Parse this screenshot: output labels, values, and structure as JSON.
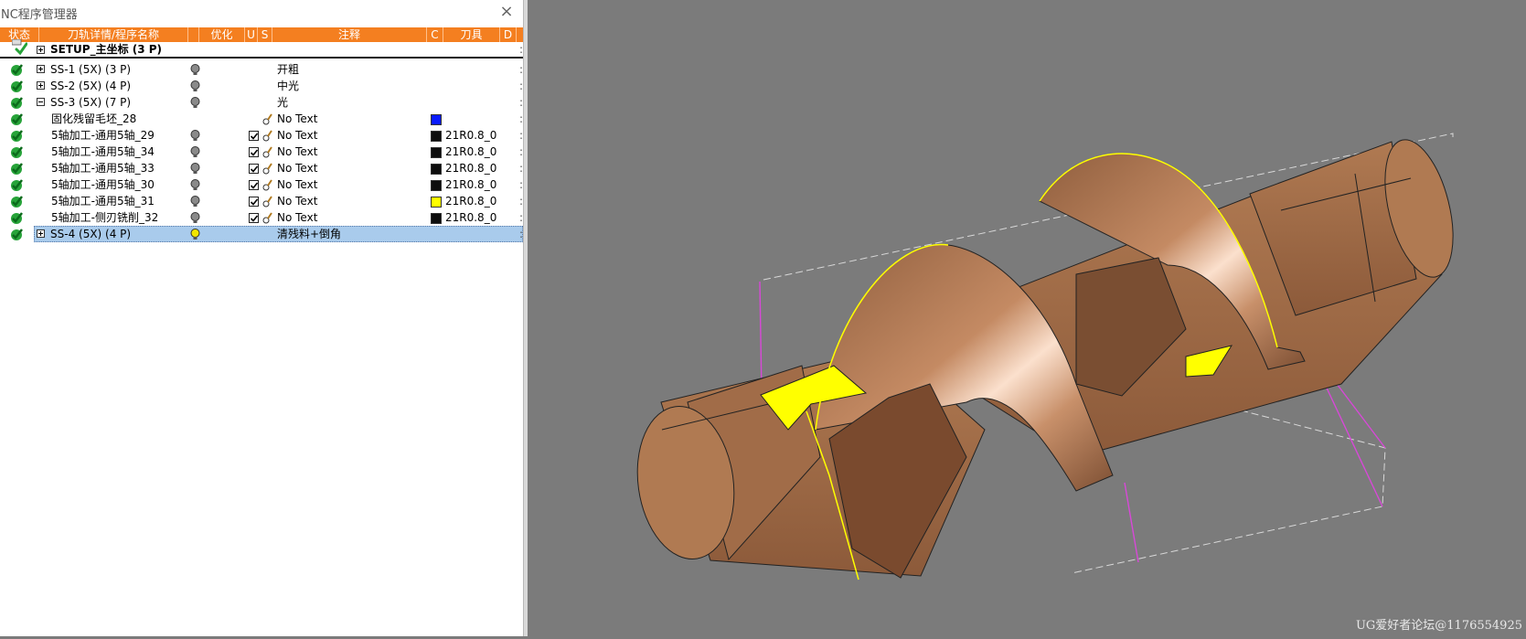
{
  "window": {
    "title": "NC程序管理器",
    "close_glyph": "×"
  },
  "columns": [
    "状态",
    "刀轨详情/程序名称",
    "优化",
    "U",
    "S",
    "注释",
    "C",
    "刀具",
    "D"
  ],
  "rows": [
    {
      "name": "SETUP_主坐标 (3 P)",
      "note": "",
      "tool": "",
      "d": ":"
    },
    {
      "name": "SS-1 (5X) (3 P)",
      "note": "开粗",
      "tool": "",
      "d": ":"
    },
    {
      "name": "SS-2 (5X) (4 P)",
      "note": "中光",
      "tool": "",
      "d": ":"
    },
    {
      "name": "SS-3 (5X) (7 P)",
      "note": "光",
      "tool": "",
      "d": ":"
    },
    {
      "name": "固化残留毛坯_28",
      "note": "No Text",
      "tool": "",
      "d": ":",
      "color": "#0a1bff"
    },
    {
      "name": "5轴加工-通用5轴_29",
      "note": "No Text",
      "tool": "21R0.8_0",
      "d": ":",
      "color": "#0d0d0d"
    },
    {
      "name": "5轴加工-通用5轴_34",
      "note": "No Text",
      "tool": "21R0.8_0",
      "d": ":",
      "color": "#0d0d0d"
    },
    {
      "name": "5轴加工-通用5轴_33",
      "note": "No Text",
      "tool": "21R0.8_0",
      "d": ":",
      "color": "#0d0d0d"
    },
    {
      "name": "5轴加工-通用5轴_30",
      "note": "No Text",
      "tool": "21R0.8_0",
      "d": ":",
      "color": "#0d0d0d"
    },
    {
      "name": "5轴加工-通用5轴_31",
      "note": "No Text",
      "tool": "21R0.8_0",
      "d": ":",
      "color": "#ffff00"
    },
    {
      "name": "5轴加工-侧刃铣削_32",
      "note": "No Text",
      "tool": "21R0.8_0",
      "d": ":",
      "color": "#0d0d0d"
    },
    {
      "name": "SS-4 (5X) (4 P)",
      "note": "清残料+倒角",
      "tool": "",
      "d": ":"
    }
  ],
  "colors": {
    "header": "#f47f20",
    "selection": "#a9cbec",
    "status_check": "#27a339",
    "part": "#b07a52",
    "toolpath_edge": "#ffff00",
    "toolpath_line": "#d848d8"
  },
  "icons": [
    "status-check-icon",
    "expand-plus-icon",
    "collapse-minus-icon",
    "bulb-icon",
    "tool-icon",
    "checkbox-icon",
    "close-icon"
  ],
  "watermark": "UG爱好者论坛@1176554925"
}
